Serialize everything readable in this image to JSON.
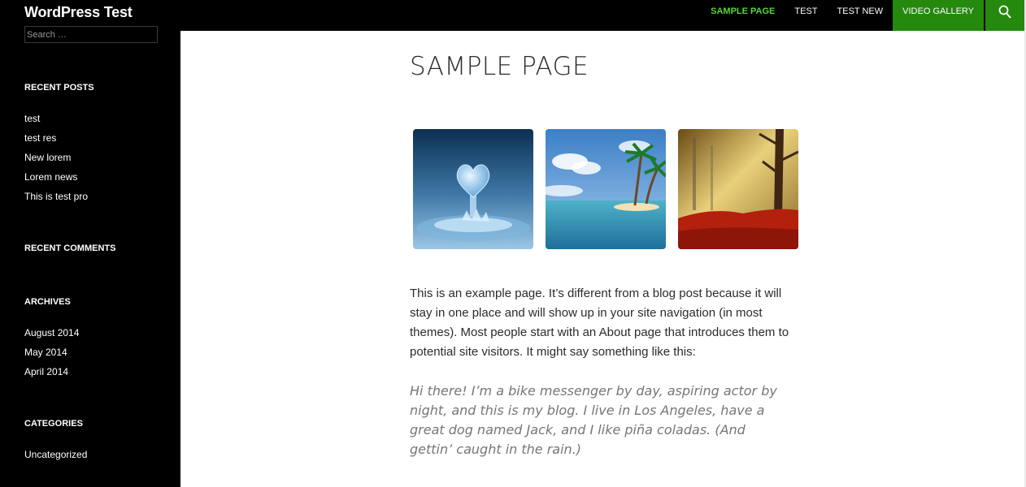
{
  "header": {
    "site_title": "WordPress Test",
    "nav": [
      "SAMPLE PAGE",
      "TEST",
      "TEST NEW",
      "VIDEO GALLERY"
    ],
    "search_icon": "search-icon"
  },
  "sidebar": {
    "search_placeholder": "Search …",
    "recent_posts": {
      "title": "RECENT POSTS",
      "items": [
        "test",
        "test res",
        "New lorem",
        "Lorem news",
        "This is test pro"
      ]
    },
    "recent_comments": {
      "title": "RECENT COMMENTS"
    },
    "archives": {
      "title": "ARCHIVES",
      "items": [
        "August 2014",
        "May 2014",
        "April 2014"
      ]
    },
    "categories": {
      "title": "CATEGORIES",
      "items": [
        "Uncategorized"
      ]
    }
  },
  "page": {
    "title": "SAMPLE PAGE",
    "gallery": [
      "water-heart-image",
      "tropical-island-image",
      "autumn-forest-image"
    ],
    "paragraph": "This is an example page. It’s different from a blog post because it will stay in one place and will show up in your site navigation (in most themes). Most people start with an About page that introduces them to potential site visitors. It might say something like this:",
    "quote": "Hi there! I’m a bike messenger by day, aspiring actor by night, and this is my blog. I live in Los Angeles, have a great dog named Jack, and I like piña coladas. (And gettin’ caught in the rain.)"
  },
  "colors": {
    "accent": "#24890d",
    "accent_text": "#55d737",
    "dark": "#000000"
  }
}
